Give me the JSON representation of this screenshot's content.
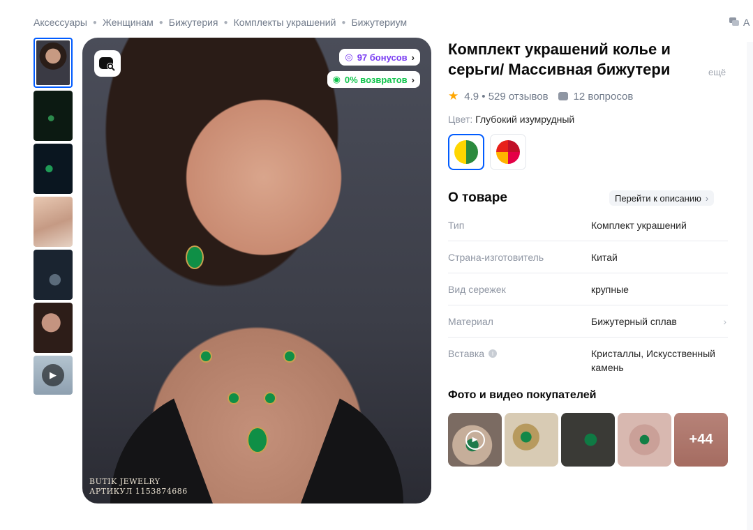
{
  "breadcrumbs": [
    "Аксессуары",
    "Женщинам",
    "Бижутерия",
    "Комплекты украшений",
    "Бижутериум"
  ],
  "top_right_label": "А",
  "main_image": {
    "bonus_badge": "97 бонусов",
    "return_badge": "0% возвратов",
    "watermark_line1": "BUTIK JEWELRY",
    "watermark_line2": "АРТИКУЛ 1153874686"
  },
  "product": {
    "title": "Комплект украшений колье и серьги/ Массивная бижутери",
    "title_more": "ещё",
    "rating": "4.9",
    "reviews": "529 отзывов",
    "questions": "12 вопросов",
    "color_label": "Цвет:",
    "color_value": "Глубокий изумрудный"
  },
  "about": {
    "heading": "О товаре",
    "goto_label": "Перейти к описанию",
    "specs": [
      {
        "key": "Тип",
        "value": "Комплект украшений"
      },
      {
        "key": "Страна-изготовитель",
        "value": "Китай"
      },
      {
        "key": "Вид сережек",
        "value": "крупные"
      },
      {
        "key": "Материал",
        "value": "Бижутерный сплав"
      },
      {
        "key": "Вставка",
        "value": "Кристаллы, Искусственный камень"
      }
    ]
  },
  "customer_photos": {
    "heading": "Фото и видео покупателей",
    "more_count": "+44"
  },
  "colors": {
    "accent": "#005bff",
    "bonus": "#7a3df2",
    "returns": "#10c44c",
    "star": "#ffa600"
  }
}
